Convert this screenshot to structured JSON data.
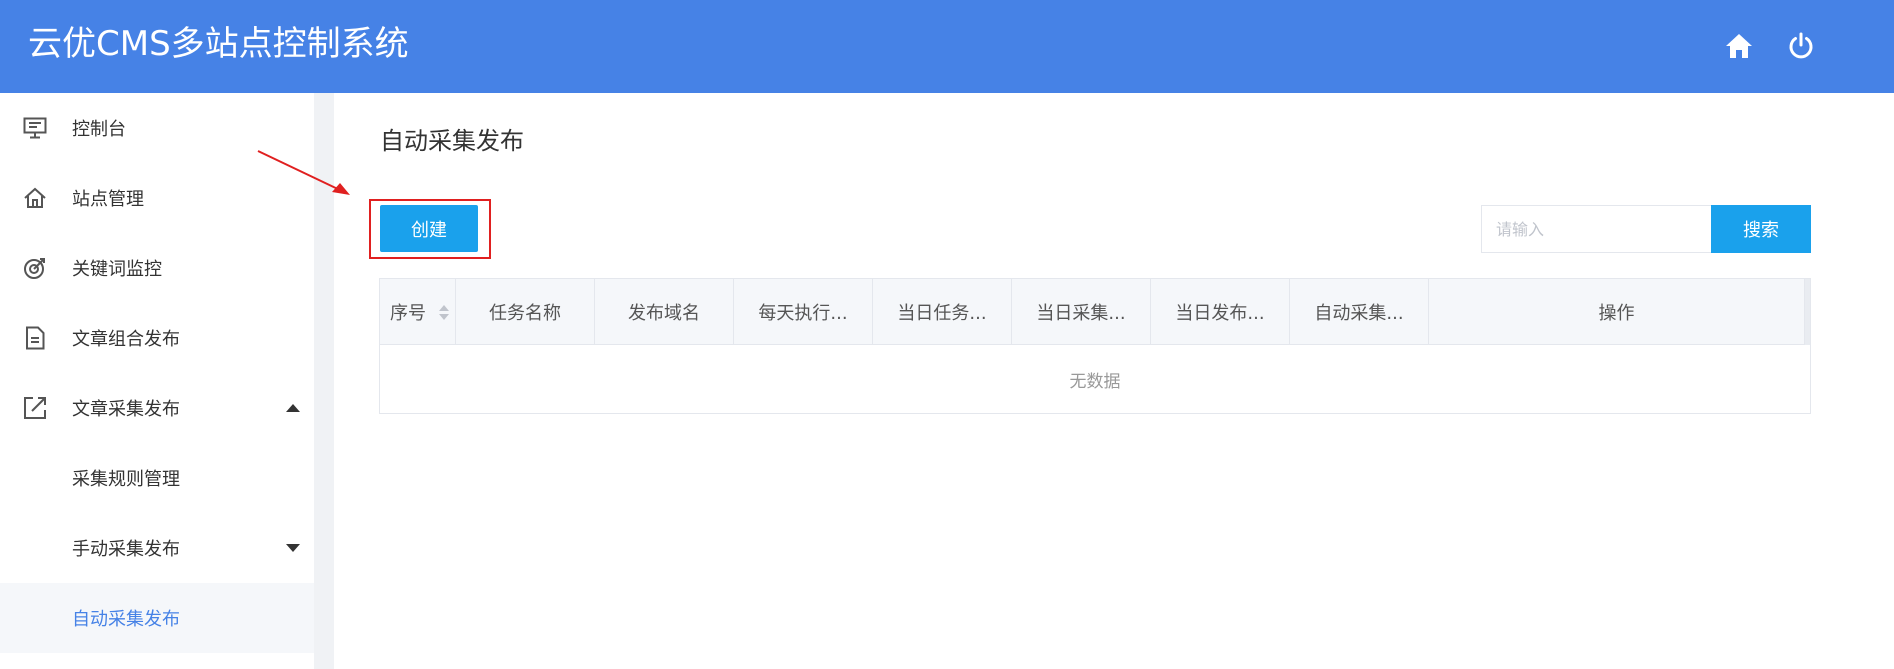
{
  "header": {
    "title": "云优CMS多站点控制系统",
    "home_icon": "home-icon",
    "power_icon": "power-icon",
    "color": "#4682e6"
  },
  "sidebar": {
    "items": [
      {
        "label": "控制台",
        "icon": "monitor-icon"
      },
      {
        "label": "站点管理",
        "icon": "home-outline-icon"
      },
      {
        "label": "关键词监控",
        "icon": "target-icon"
      },
      {
        "label": "文章组合发布",
        "icon": "document-icon"
      },
      {
        "label": "文章采集发布",
        "icon": "external-link-icon",
        "expanded": true
      },
      {
        "label": "采集规则管理"
      },
      {
        "label": "手动采集发布",
        "expanded": false
      },
      {
        "label": "自动采集发布",
        "active": true
      }
    ]
  },
  "main": {
    "page_title": "自动采集发布",
    "create_label": "创建",
    "search": {
      "placeholder": "请输入",
      "value": "",
      "button_label": "搜索"
    },
    "table": {
      "columns": [
        "序号",
        "任务名称",
        "发布域名",
        "每天执行...",
        "当日任务...",
        "当日采集...",
        "当日发布...",
        "自动采集...",
        "操作"
      ],
      "empty_text": "无数据"
    }
  },
  "colors": {
    "accent": "#1aa1ec",
    "annotation": "#e02020",
    "active_text": "#4682e6"
  }
}
